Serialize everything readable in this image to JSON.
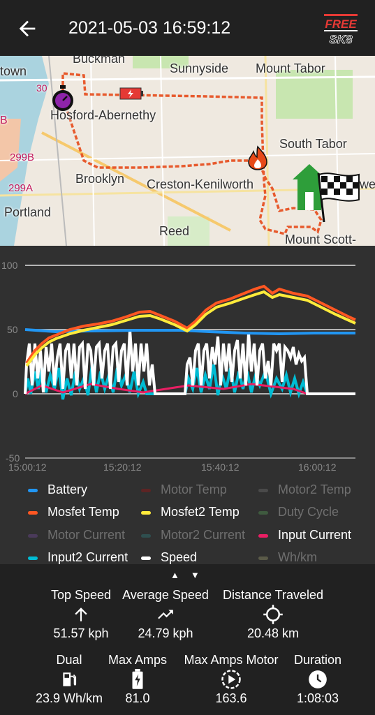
{
  "header": {
    "title": "2021-05-03 16:59:12",
    "logo_text": "FREESK8"
  },
  "map": {
    "labels": [
      "Buckman",
      "Sunnyside",
      "Mount Tabor",
      "town",
      "Hosford-Abernethy",
      "South Tabor",
      "299B",
      "Brooklyn",
      "Creston-Kenilworth",
      "299A",
      "Portland",
      "Reed",
      "Mount Scott-",
      "30",
      "B",
      "wel"
    ]
  },
  "chart": {
    "y_ticks": [
      "100",
      "50",
      "0",
      "-50"
    ],
    "x_ticks": [
      "15:00:12",
      "15:20:12",
      "15:40:12",
      "16:00:12"
    ]
  },
  "legend": [
    {
      "label": "Battery",
      "color": "#2196f3",
      "on": true
    },
    {
      "label": "Motor Temp",
      "color": "#5d2424",
      "on": false
    },
    {
      "label": "Motor2 Temp",
      "color": "#4a4a4a",
      "on": false
    },
    {
      "label": "Mosfet Temp",
      "color": "#ff5722",
      "on": true
    },
    {
      "label": "Mosfet2 Temp",
      "color": "#ffeb3b",
      "on": true
    },
    {
      "label": "Duty Cycle",
      "color": "#3f5a3f",
      "on": false
    },
    {
      "label": "Motor Current",
      "color": "#4a3a5a",
      "on": false
    },
    {
      "label": "Motor2 Current",
      "color": "#2f4f4f",
      "on": false
    },
    {
      "label": "Input Current",
      "color": "#e91e63",
      "on": true
    },
    {
      "label": "Input2 Current",
      "color": "#00bcd4",
      "on": true
    },
    {
      "label": "Speed",
      "color": "#ffffff",
      "on": true
    },
    {
      "label": "Wh/km",
      "color": "#5a5a48",
      "on": false
    }
  ],
  "stats": {
    "top_speed": {
      "label": "Top Speed",
      "value": "51.57 kph",
      "icon": "arrow-up-icon"
    },
    "avg_speed": {
      "label": "Average Speed",
      "value": "24.79 kph",
      "icon": "trending-up-icon"
    },
    "distance": {
      "label": "Distance Traveled",
      "value": "20.48 km",
      "icon": "gps-icon"
    },
    "dual": {
      "label": "Dual",
      "value": "23.9 Wh/km",
      "icon": "fuel-icon"
    },
    "max_amps": {
      "label": "Max Amps",
      "value": "81.0",
      "icon": "battery-charging-icon"
    },
    "max_amps_motor": {
      "label": "Max Amps Motor",
      "value": "163.6",
      "icon": "motor-icon"
    },
    "duration": {
      "label": "Duration",
      "value": "1:08:03",
      "icon": "clock-icon"
    }
  }
}
